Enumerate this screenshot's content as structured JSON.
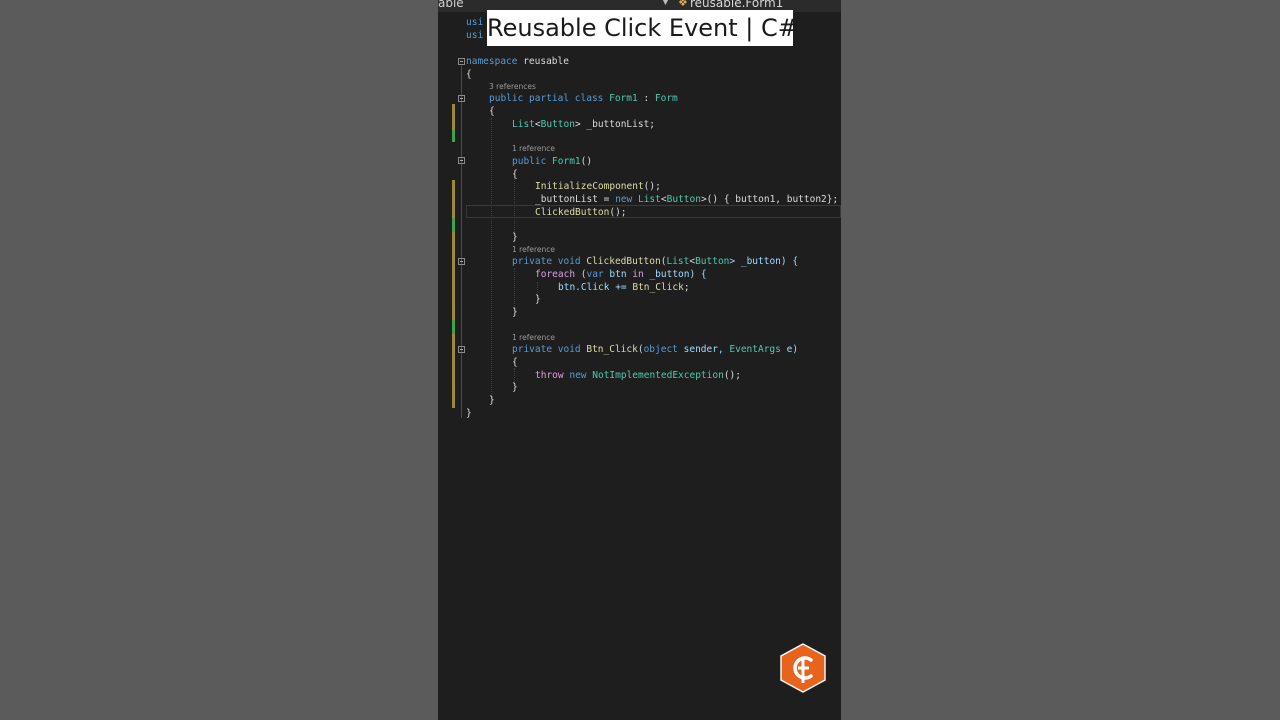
{
  "title_banner": "Reusable Click Event | C#",
  "editor": {
    "project_label": "able",
    "class_label": "reusable.Form1"
  },
  "code_lines": {
    "using1": "usi",
    "using2": "usi",
    "ns_kw": "namespace",
    "ns_name": " reusable",
    "brace_open": "{",
    "refs_class": "3 references",
    "class_kw": "public partial class",
    "class_name": " Form1",
    "class_sep": " : ",
    "class_base": "Form",
    "class_open": "{",
    "field_type1": "List",
    "field_lt": "<",
    "field_type2": "Button",
    "field_rest": "> _buttonList;",
    "refs_ctor": "1 reference",
    "ctor_kw": "public",
    "ctor_name": " Form1",
    "ctor_parens": "()",
    "ctor_open": "{",
    "init_call": "InitializeComponent",
    "init_rest": "();",
    "assign_lhs": "_buttonList = ",
    "assign_new": "new",
    "assign_sp": " ",
    "assign_type1": "List",
    "assign_lt": "<",
    "assign_type2": "Button",
    "assign_rest": ">() { button1, button2};",
    "clicked_call": "ClickedButton",
    "clicked_rest": "();",
    "ctor_close": "}",
    "refs_clicked": "1 reference",
    "m1_kw": "private void",
    "m1_name": " ClickedButton",
    "m1_paren": "(",
    "m1_type1": "List",
    "m1_lt": "<",
    "m1_type2": "Button",
    "m1_rest": "> _button) {",
    "foreach_kw": "foreach",
    "foreach_paren": " (",
    "foreach_var": "var",
    "foreach_btn": " btn ",
    "foreach_in": "in",
    "foreach_rest": " _button) {",
    "click_lhs": "btn.Click += ",
    "click_handler": "Btn_Click",
    "click_end": ";",
    "foreach_close": "}",
    "m1_close": "}",
    "refs_btnclick": "1 reference",
    "m2_kw": "private void",
    "m2_name": " Btn_Click",
    "m2_paren": "(",
    "m2_obj": "object",
    "m2_sender": " sender, ",
    "m2_args": "EventArgs",
    "m2_rest": " e)",
    "m2_open": "{",
    "throw_kw": "throw",
    "throw_sp": " ",
    "throw_new": "new",
    "throw_sp2": " ",
    "throw_type": "NotImplementedException",
    "throw_rest": "();",
    "m2_close": "}",
    "class_close": "}",
    "ns_close": "}"
  },
  "colors": {
    "keyword": "#569cd6",
    "control": "#d8a0df",
    "type": "#4ec9b0",
    "method": "#dcdcaa",
    "parameter": "#9cdcfe",
    "logo_orange": "#e8641c"
  },
  "logo": {
    "icon": "csharp-logo-icon"
  }
}
